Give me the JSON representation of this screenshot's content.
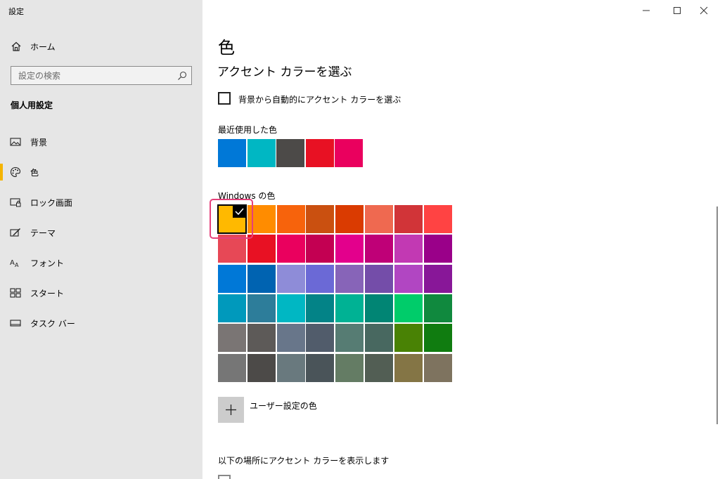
{
  "window": {
    "title": "設定"
  },
  "sidebar": {
    "home_label": "ホーム",
    "search_placeholder": "設定の検索",
    "section_title": "個人用設定",
    "items": [
      {
        "label": "背景",
        "icon": "image-icon"
      },
      {
        "label": "色",
        "icon": "palette-icon",
        "selected": true
      },
      {
        "label": "ロック画面",
        "icon": "lock-screen-icon"
      },
      {
        "label": "テーマ",
        "icon": "theme-icon"
      },
      {
        "label": "フォント",
        "icon": "font-icon"
      },
      {
        "label": "スタート",
        "icon": "start-icon"
      },
      {
        "label": "タスク バー",
        "icon": "taskbar-icon"
      }
    ],
    "selection_color": "#f5b400"
  },
  "main": {
    "title": "色",
    "subtitle": "アクセント カラーを選ぶ",
    "auto_checkbox": {
      "label": "背景から自動的にアクセント カラーを選ぶ",
      "checked": false
    },
    "recent_label": "最近使用した色",
    "recent_colors": [
      "#0078d7",
      "#00b7c3",
      "#4c4a48",
      "#e81123",
      "#ea005e"
    ],
    "windows_label": "Windows の色",
    "windows_colors": [
      [
        "#ffb900",
        "#ff8c00",
        "#f7630c",
        "#ca5010",
        "#da3b01",
        "#ef6950",
        "#d13438",
        "#ff4343"
      ],
      [
        "#e74856",
        "#e81123",
        "#ea005e",
        "#c30052",
        "#e3008c",
        "#bf0077",
        "#c239b3",
        "#9a0089"
      ],
      [
        "#0078d7",
        "#0063b1",
        "#8e8cd8",
        "#6b69d6",
        "#8764b8",
        "#744da9",
        "#b146c2",
        "#881798"
      ],
      [
        "#0099bc",
        "#2d7d9a",
        "#00b7c3",
        "#038387",
        "#00b294",
        "#018574",
        "#00cc6a",
        "#10893e"
      ],
      [
        "#7a7574",
        "#5d5a58",
        "#68768a",
        "#515c6b",
        "#567c73",
        "#486860",
        "#498205",
        "#107c10"
      ],
      [
        "#767676",
        "#4c4a48",
        "#69797e",
        "#4a5459",
        "#647c64",
        "#525e54",
        "#847545",
        "#7e735f"
      ]
    ],
    "selected_color": {
      "row": 0,
      "col": 0,
      "value": "#ffb900"
    },
    "highlight_color": "#e5407a",
    "custom_color_label": "ユーザー設定の色",
    "show_accent_label": "以下の場所にアクセント カラーを表示します"
  }
}
